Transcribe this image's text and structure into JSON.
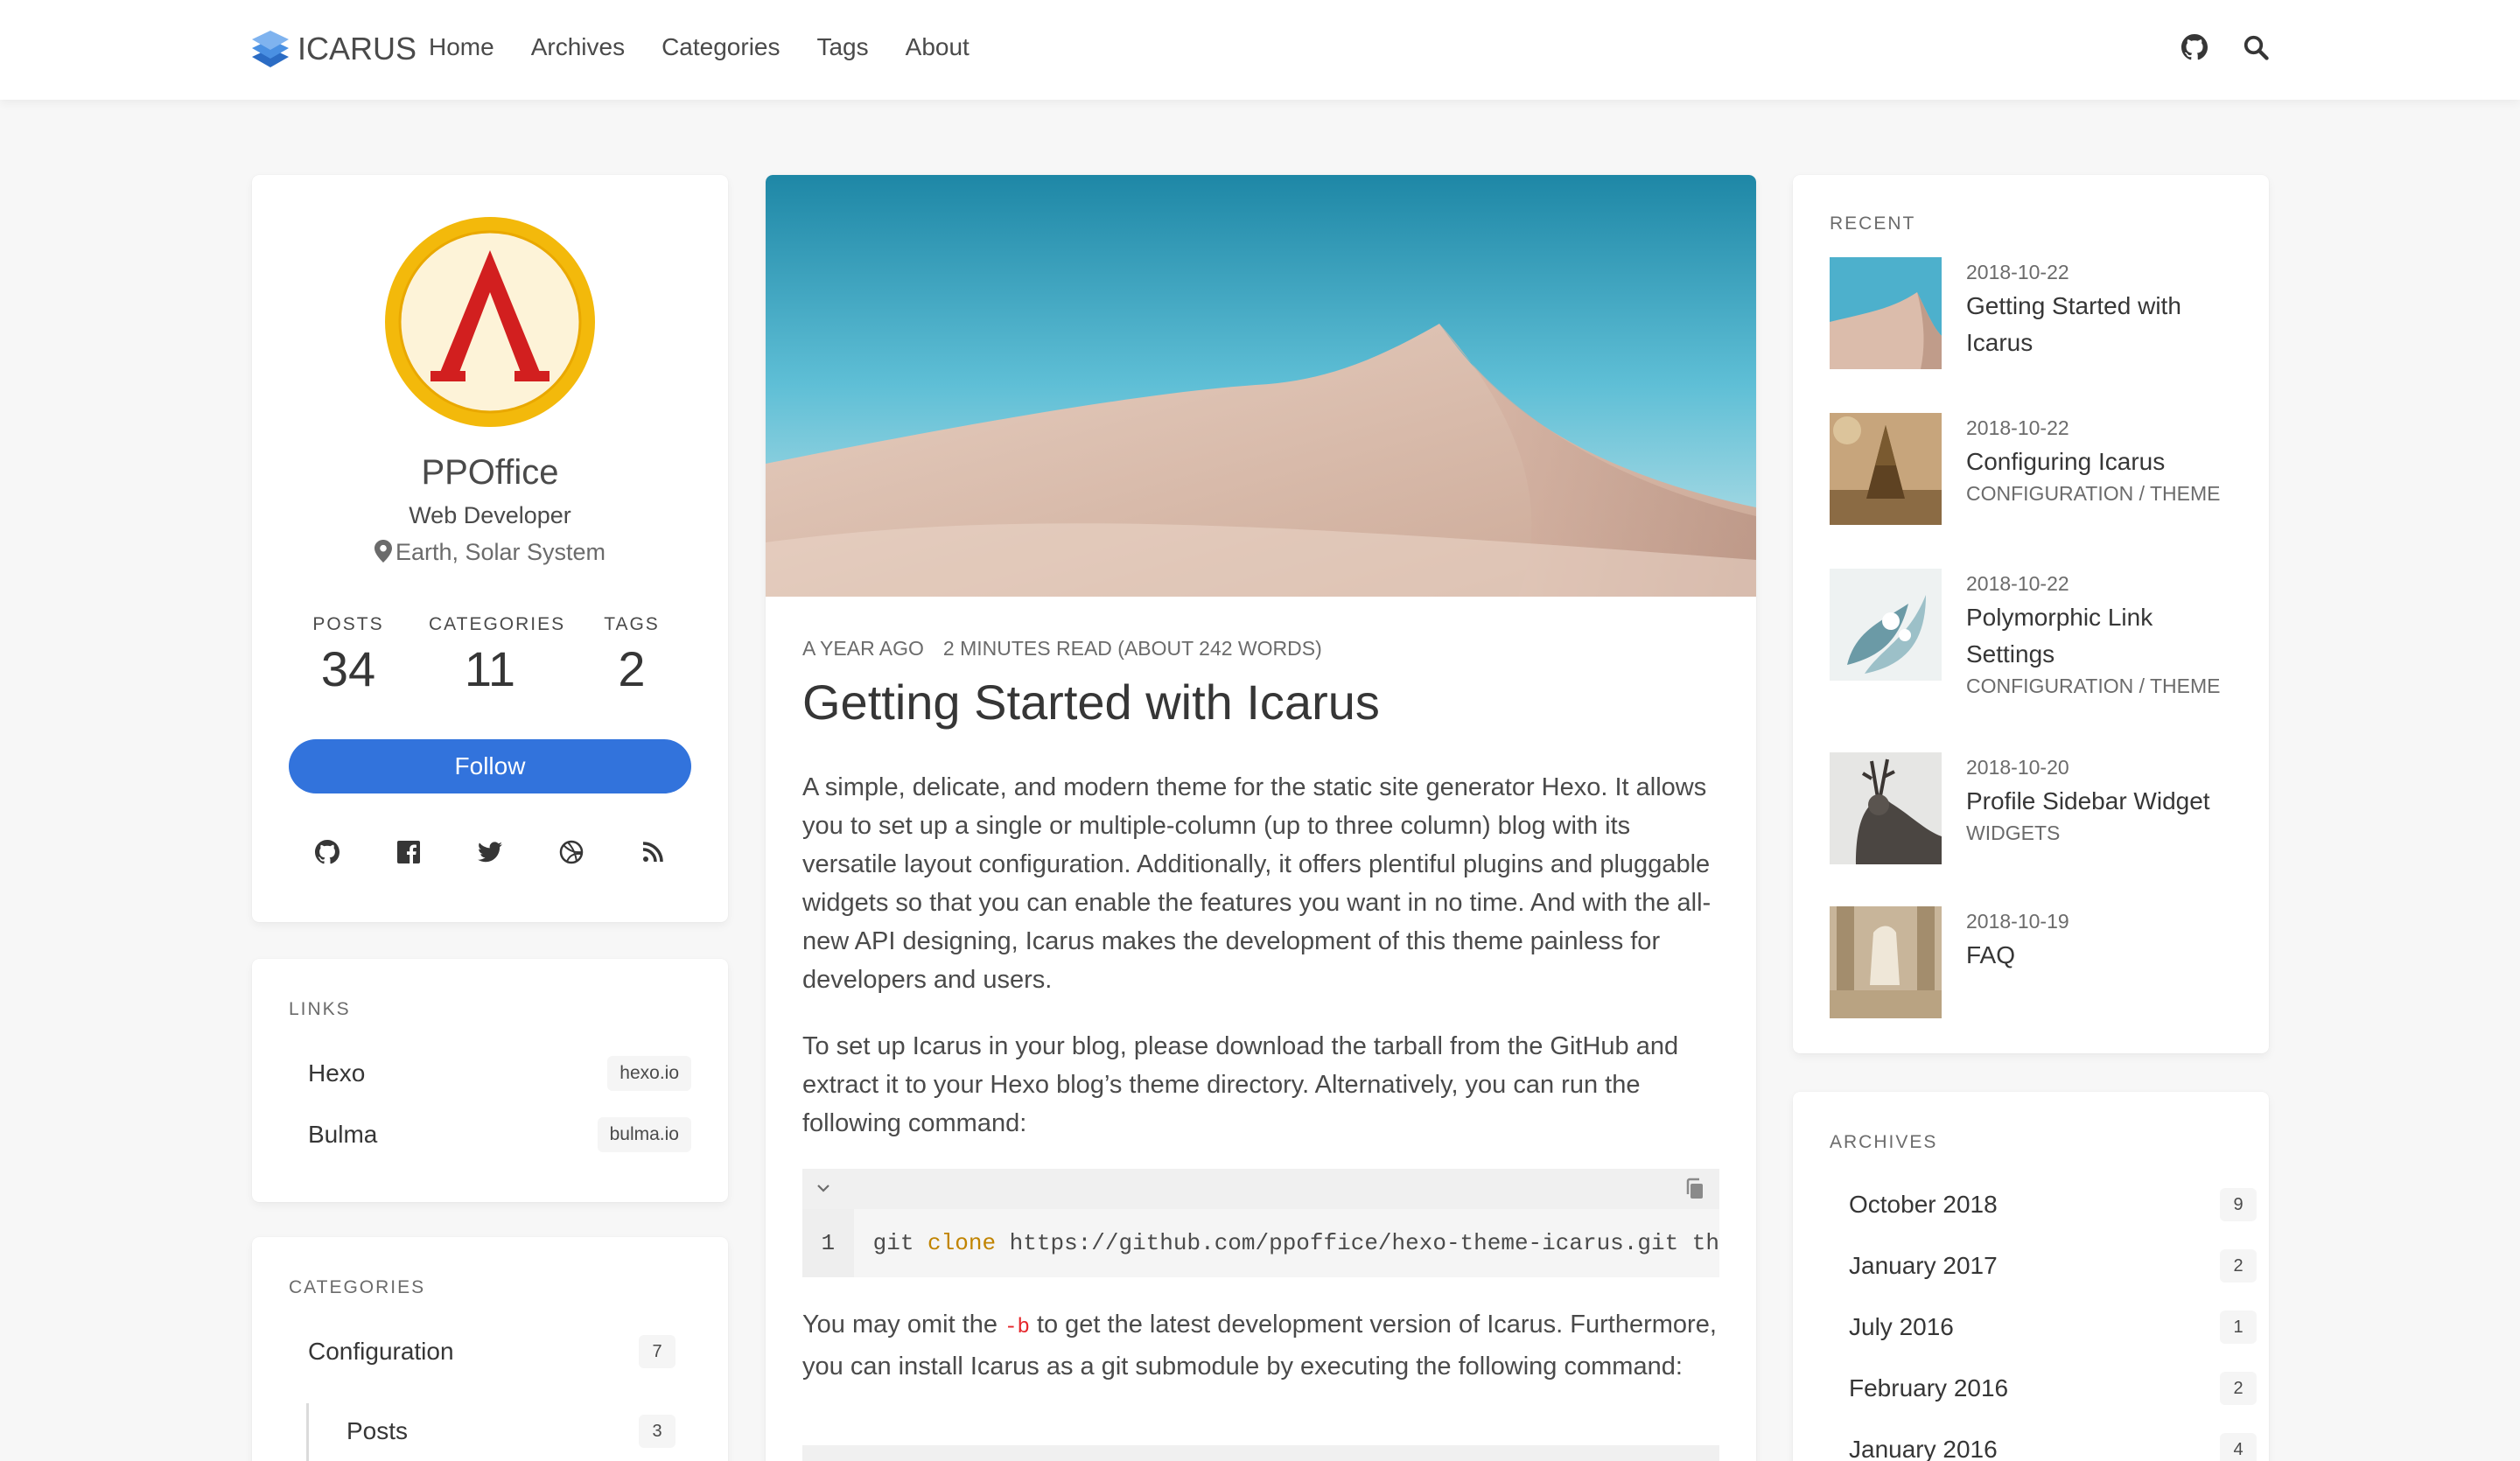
{
  "brand": {
    "name": "ICARUS"
  },
  "nav": {
    "items": [
      {
        "label": "Home"
      },
      {
        "label": "Archives"
      },
      {
        "label": "Categories"
      },
      {
        "label": "Tags"
      },
      {
        "label": "About"
      }
    ],
    "icons": [
      "github-icon",
      "search-icon"
    ]
  },
  "profile": {
    "name": "PPOffice",
    "title": "Web Developer",
    "location": "Earth, Solar System",
    "stats": [
      {
        "label": "POSTS",
        "value": "34"
      },
      {
        "label": "CATEGORIES",
        "value": "11"
      },
      {
        "label": "TAGS",
        "value": "2"
      }
    ],
    "follow_label": "Follow",
    "socials": [
      "github-icon",
      "facebook-icon",
      "twitter-icon",
      "dribbble-icon",
      "rss-icon"
    ]
  },
  "links": {
    "heading": "LINKS",
    "items": [
      {
        "name": "Hexo",
        "url": "hexo.io"
      },
      {
        "name": "Bulma",
        "url": "bulma.io"
      }
    ]
  },
  "categories": {
    "heading": "CATEGORIES",
    "items": [
      {
        "name": "Configuration",
        "count": "7"
      },
      {
        "name": "Posts",
        "count": "3"
      }
    ]
  },
  "article": {
    "time": "A YEAR AGO",
    "reading": "2 MINUTES READ (ABOUT 242 WORDS)",
    "title": "Getting Started with Icarus",
    "para1": "A simple, delicate, and modern theme for the static site generator Hexo. It allows you to set up a single or multiple-column (up to three column) blog with its versatile layout configuration. Additionally, it offers plentiful plugins and pluggable widgets so that you can enable the features you want in no time. And with the all-new API designing, Icarus makes the development of this theme painless for developers and users.",
    "para2": "To set up Icarus in your blog, please download the tarball from the GitHub and extract it to your Hexo blog’s theme directory. Alternatively, you can run the following command:",
    "code_line_number": "1",
    "code_cmd": "git",
    "code_kw": "clone",
    "code_rest": "https://github.com/ppoffice/hexo-theme-icarus.git th",
    "para3_a": "You may omit the",
    "para3_code": "-b",
    "para3_b": "to get the latest development version of Icarus. Furthermore, you can install Icarus as a git submodule by executing the following command:"
  },
  "recent": {
    "heading": "RECENT",
    "items": [
      {
        "date": "2018-10-22",
        "title": "Getting Started with Icarus",
        "cat": "",
        "cat2": ""
      },
      {
        "date": "2018-10-22",
        "title": "Configuring Icarus",
        "cat": "CONFIGURATION",
        "cat2": "THEME"
      },
      {
        "date": "2018-10-22",
        "title": "Polymorphic Link Settings",
        "cat": "CONFIGURATION",
        "cat2": "THEME"
      },
      {
        "date": "2018-10-20",
        "title": "Profile Sidebar Widget",
        "cat": "WIDGETS",
        "cat2": ""
      },
      {
        "date": "2018-10-19",
        "title": "FAQ",
        "cat": "",
        "cat2": ""
      }
    ],
    "separator": "/"
  },
  "archives": {
    "heading": "ARCHIVES",
    "items": [
      {
        "name": "October 2018",
        "count": "9"
      },
      {
        "name": "January 2017",
        "count": "2"
      },
      {
        "name": "July 2016",
        "count": "1"
      },
      {
        "name": "February 2016",
        "count": "2"
      },
      {
        "name": "January 2016",
        "count": "4"
      }
    ]
  },
  "colors": {
    "accent": "#3273dc",
    "avatar_ring": "#f3b90b",
    "avatar_mark": "#d21f1f"
  }
}
